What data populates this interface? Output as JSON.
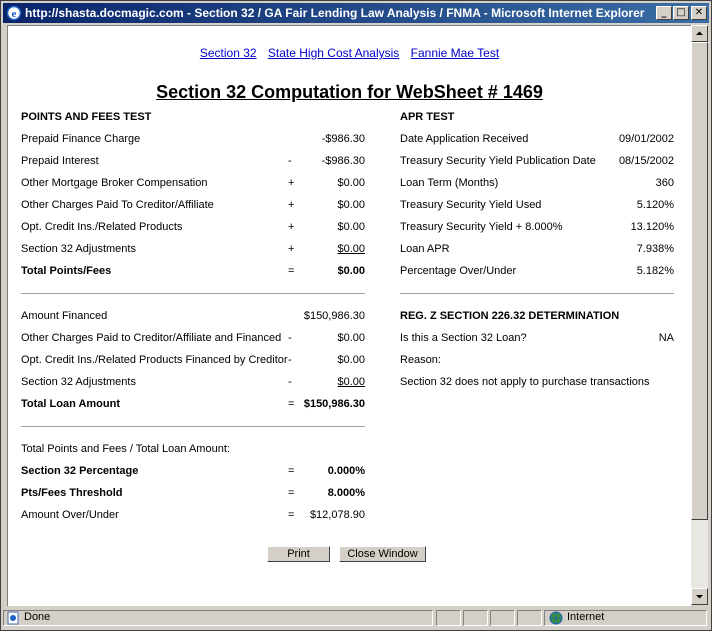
{
  "window": {
    "title": "http://shasta.docmagic.com - Section 32 / GA Fair Lending Law Analysis / FNMA - Microsoft Internet Explorer",
    "minimize": "_",
    "maximize": "□",
    "close": "✕"
  },
  "nav_links": [
    "Section 32",
    "State High Cost Analysis",
    "Fannie Mae Test"
  ],
  "heading": "Section 32 Computation for WebSheet # 1469",
  "points_and_fees": {
    "header": "POINTS AND FEES TEST",
    "rows": [
      {
        "label": "Prepaid Finance Charge",
        "op": "",
        "value": "-$986.30"
      },
      {
        "label": "Prepaid Interest",
        "op": "-",
        "value": "-$986.30"
      },
      {
        "label": "Other Mortgage Broker Compensation",
        "op": "+",
        "value": "$0.00"
      },
      {
        "label": "Other Charges Paid To Creditor/Affiliate",
        "op": "+",
        "value": "$0.00"
      },
      {
        "label": "Opt. Credit Ins./Related Products",
        "op": "+",
        "value": "$0.00"
      },
      {
        "label": "Section 32 Adjustments",
        "op": "+",
        "value": "$0.00"
      },
      {
        "label": "Total Points/Fees",
        "op": "=",
        "value": "$0.00"
      }
    ]
  },
  "loan_amount": {
    "rows": [
      {
        "label": "Amount Financed",
        "op": "",
        "value": "$150,986.30"
      },
      {
        "label": "Other Charges Paid to Creditor/Affiliate and Financed",
        "op": "-",
        "value": "$0.00"
      },
      {
        "label": "Opt. Credit Ins./Related Products Financed by Creditor",
        "op": "-",
        "value": "$0.00"
      },
      {
        "label": "Section 32 Adjustments",
        "op": "-",
        "value": "$0.00"
      },
      {
        "label": "Total Loan Amount",
        "op": "=",
        "value": "$150,986.30"
      }
    ]
  },
  "ratio": {
    "caption": "Total Points and Fees / Total Loan Amount:",
    "rows": [
      {
        "label": "Section 32 Percentage",
        "op": "=",
        "value": "0.000%"
      },
      {
        "label": "Pts/Fees Threshold",
        "op": "=",
        "value": "8.000%"
      },
      {
        "label": "Amount Over/Under",
        "op": "=",
        "value": "$12,078.90"
      }
    ]
  },
  "apr_test": {
    "header": "APR TEST",
    "rows": [
      {
        "label": "Date Application Received",
        "value": "09/01/2002"
      },
      {
        "label": "Treasury Security Yield Publication Date",
        "value": "08/15/2002"
      },
      {
        "label": "Loan Term (Months)",
        "value": "360"
      },
      {
        "label": "Treasury Security Yield Used",
        "value": "5.120%"
      },
      {
        "label": "Treasury Security Yield + 8.000%",
        "value": "13.120%"
      },
      {
        "label": "Loan APR",
        "value": "7.938%"
      },
      {
        "label": "Percentage Over/Under",
        "value": "5.182%"
      }
    ]
  },
  "determination": {
    "header": "REG. Z SECTION 226.32 DETERMINATION",
    "question": "Is this a Section 32 Loan?",
    "answer": "NA",
    "reason_label": "Reason:",
    "reason_text": "Section 32 does not apply to purchase transactions"
  },
  "buttons": {
    "print": "Print",
    "close": "Close Window"
  },
  "status": {
    "text": "Done",
    "zone": "Internet"
  }
}
